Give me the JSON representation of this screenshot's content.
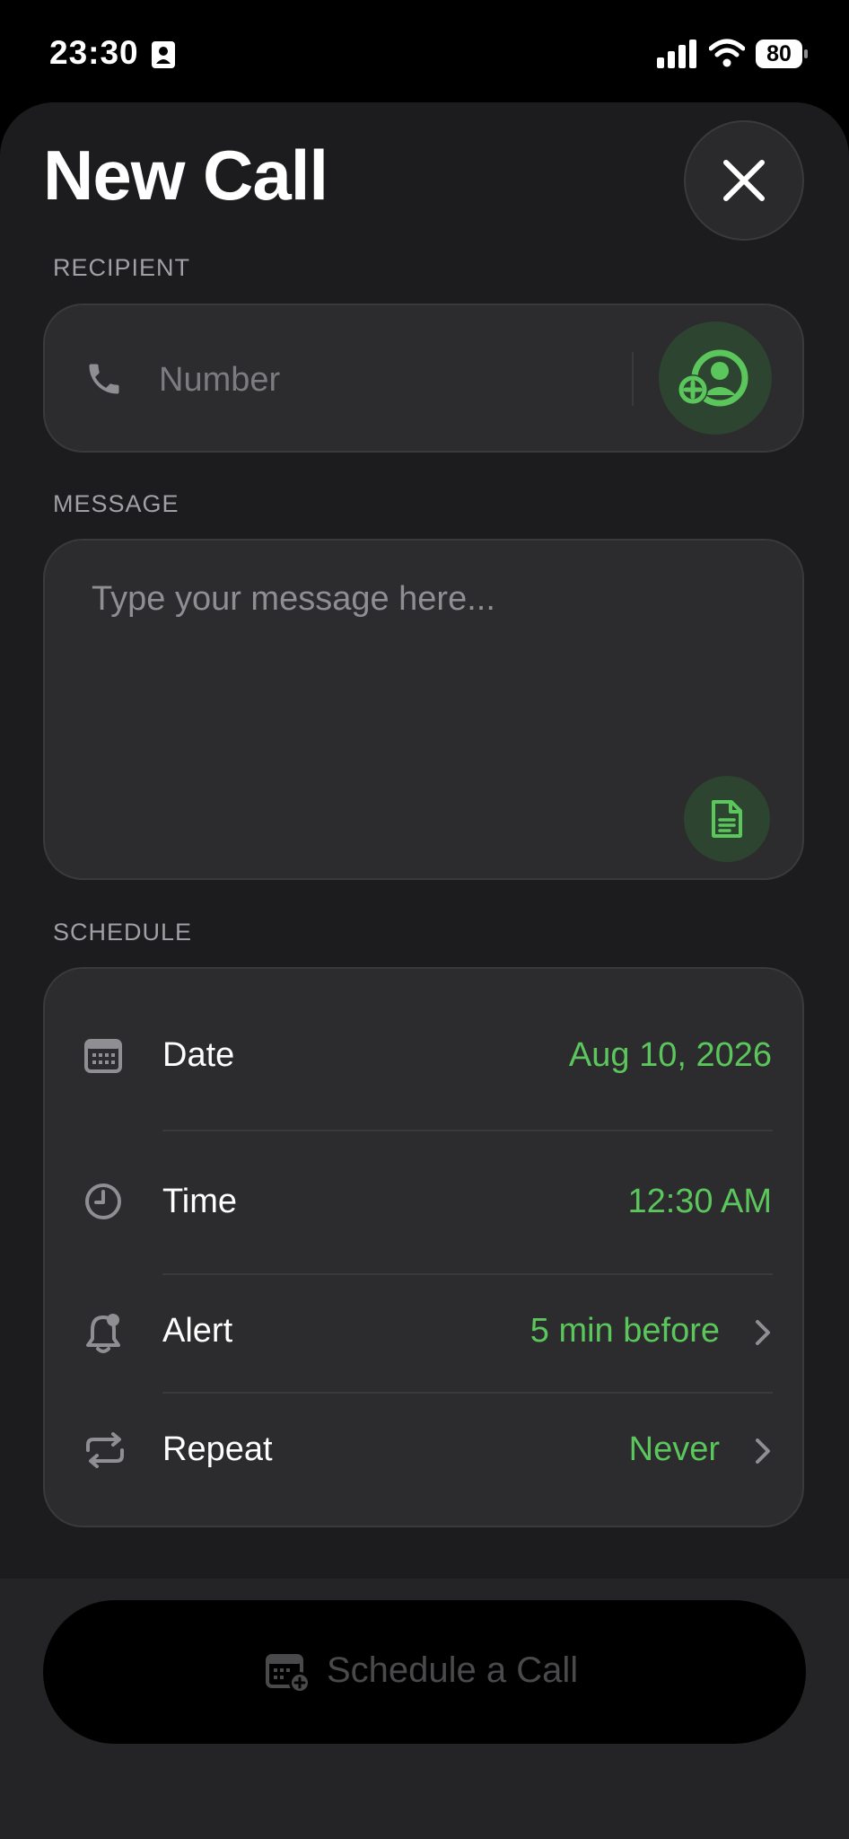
{
  "status_bar": {
    "time": "23:30",
    "battery": "80"
  },
  "header": {
    "title": "New Call"
  },
  "recipient": {
    "label": "RECIPIENT",
    "placeholder": "Number"
  },
  "message": {
    "label": "MESSAGE",
    "placeholder": "Type your message here..."
  },
  "schedule": {
    "label": "SCHEDULE",
    "rows": [
      {
        "label": "Date",
        "value": "Aug 10, 2026",
        "icon": "calendar-icon"
      },
      {
        "label": "Time",
        "value": "12:30 AM",
        "icon": "clock-icon"
      },
      {
        "label": "Alert",
        "value": "5 min before",
        "icon": "bell-icon"
      },
      {
        "label": "Repeat",
        "value": "Never",
        "icon": "repeat-icon"
      }
    ]
  },
  "action": {
    "schedule_label": "Schedule a Call"
  },
  "colors": {
    "accent": "#5bc65c",
    "sheet": "#1c1c1e",
    "card": "#2c2c2e"
  }
}
